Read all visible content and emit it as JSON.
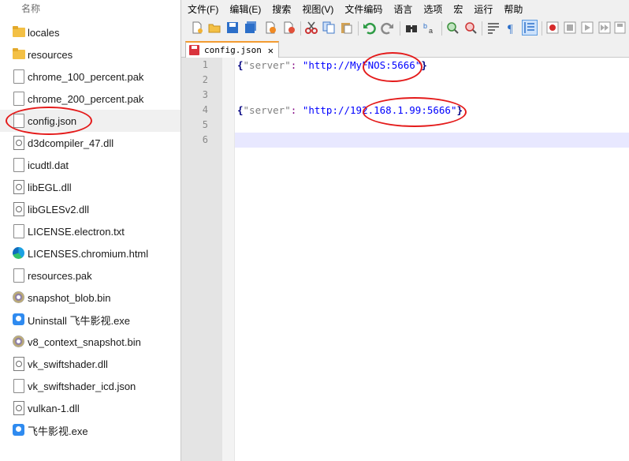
{
  "explorer": {
    "column_header": "名称",
    "items": [
      {
        "name": "locales",
        "icon": "folder-icon"
      },
      {
        "name": "resources",
        "icon": "folder-icon"
      },
      {
        "name": "chrome_100_percent.pak",
        "icon": "file-icon"
      },
      {
        "name": "chrome_200_percent.pak",
        "icon": "file-icon"
      },
      {
        "name": "config.json",
        "icon": "file-icon",
        "selected": true
      },
      {
        "name": "d3dcompiler_47.dll",
        "icon": "dll-icon"
      },
      {
        "name": "icudtl.dat",
        "icon": "file-icon"
      },
      {
        "name": "libEGL.dll",
        "icon": "dll-icon"
      },
      {
        "name": "libGLESv2.dll",
        "icon": "dll-icon"
      },
      {
        "name": "LICENSE.electron.txt",
        "icon": "text-file-icon"
      },
      {
        "name": "LICENSES.chromium.html",
        "icon": "edge-icon"
      },
      {
        "name": "resources.pak",
        "icon": "file-icon"
      },
      {
        "name": "snapshot_blob.bin",
        "icon": "disc-icon"
      },
      {
        "name": "Uninstall 飞牛影视.exe",
        "icon": "app-icon"
      },
      {
        "name": "v8_context_snapshot.bin",
        "icon": "disc-icon"
      },
      {
        "name": "vk_swiftshader.dll",
        "icon": "dll-icon"
      },
      {
        "name": "vk_swiftshader_icd.json",
        "icon": "file-icon"
      },
      {
        "name": "vulkan-1.dll",
        "icon": "dll-icon"
      },
      {
        "name": "飞牛影视.exe",
        "icon": "app-icon"
      }
    ]
  },
  "editor_app": {
    "menu": [
      "文件(F)",
      "编辑(E)",
      "搜索",
      "视图(V)",
      "文件编码",
      "语言",
      "选项",
      "宏",
      "运行",
      "帮助"
    ],
    "toolbar_icons": [
      "new-file-icon",
      "open-file-icon",
      "save-icon",
      "save-all-icon",
      "close-icon",
      "close-all-icon",
      "print-icon",
      "cut-icon",
      "copy-icon",
      "paste-icon",
      "undo-icon",
      "redo-icon",
      "find-icon",
      "replace-icon",
      "zoom-in-icon",
      "zoom-out-icon",
      "word-wrap-icon",
      "show-all-chars-icon",
      "indent-guide-icon",
      "record-macro-icon",
      "stop-record-icon",
      "play-macro-icon",
      "run-macro-multiple-icon",
      "save-macro-icon"
    ],
    "tab": {
      "label": "config.json",
      "close": "✕"
    },
    "line_numbers": [
      "1",
      "2",
      "3",
      "4",
      "5",
      "6"
    ],
    "lines": [
      {
        "open": "{",
        "key": "\"server\"",
        "colon": ":",
        "value": "\"http://MyFNOS:5666\"",
        "close": "}"
      },
      {
        "open": "",
        "key": "",
        "colon": "",
        "value": "",
        "close": ""
      },
      {
        "open": "",
        "key": "",
        "colon": "",
        "value": "",
        "close": ""
      },
      {
        "open": "{",
        "key": "\"server\"",
        "colon": ":",
        "value": "\"http://192.168.1.99:5666\"",
        "close": "}"
      },
      {
        "open": "",
        "key": "",
        "colon": "",
        "value": "",
        "close": ""
      },
      {
        "open": "",
        "key": "",
        "colon": "",
        "value": "",
        "close": ""
      }
    ],
    "colors": {
      "brace": "#000080",
      "key": "#808080",
      "value": "#0000ff",
      "current_line": "#e8e8ff",
      "annotation": "#e41b1b"
    }
  }
}
